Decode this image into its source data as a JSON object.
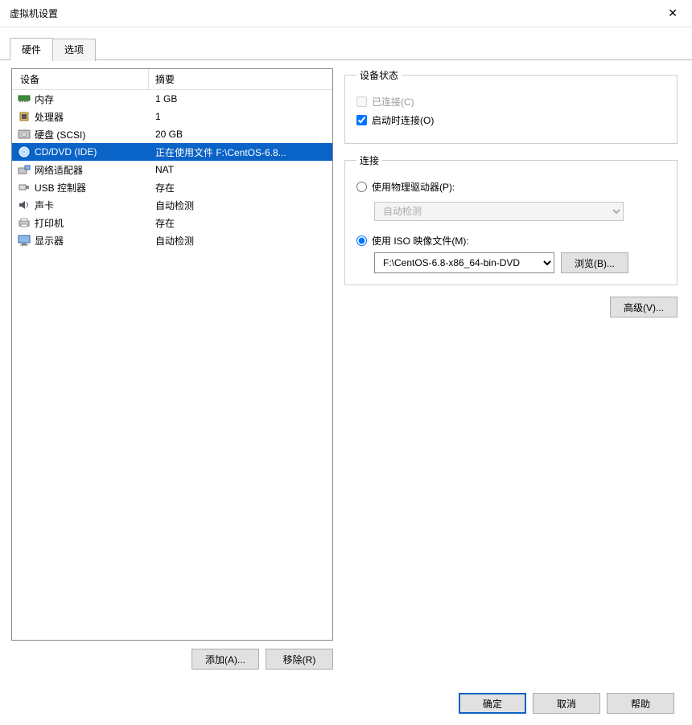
{
  "window": {
    "title": "虚拟机设置"
  },
  "tabs": {
    "hardware": "硬件",
    "options": "选项"
  },
  "columns": {
    "device": "设备",
    "summary": "摘要"
  },
  "devices": [
    {
      "icon": "memory",
      "name": "内存",
      "summary": "1 GB"
    },
    {
      "icon": "cpu",
      "name": "处理器",
      "summary": "1"
    },
    {
      "icon": "disk",
      "name": "硬盘 (SCSI)",
      "summary": "20 GB"
    },
    {
      "icon": "cd",
      "name": "CD/DVD (IDE)",
      "summary": "正在使用文件 F:\\CentOS-6.8..."
    },
    {
      "icon": "net",
      "name": "网络适配器",
      "summary": "NAT"
    },
    {
      "icon": "usb",
      "name": "USB 控制器",
      "summary": "存在"
    },
    {
      "icon": "sound",
      "name": "声卡",
      "summary": "自动检测"
    },
    {
      "icon": "printer",
      "name": "打印机",
      "summary": "存在"
    },
    {
      "icon": "display",
      "name": "显示器",
      "summary": "自动检测"
    }
  ],
  "selectedIndex": 3,
  "leftButtons": {
    "add": "添加(A)...",
    "remove": "移除(R)"
  },
  "deviceStatus": {
    "legend": "设备状态",
    "connected": {
      "label": "已连接(C)",
      "checked": false,
      "disabled": true
    },
    "connectAtStart": {
      "label": "启动时连接(O)",
      "checked": true
    }
  },
  "connection": {
    "legend": "连接",
    "physical": {
      "label": "使用物理驱动器(P):",
      "checked": false
    },
    "physicalSelectValue": "自动检测",
    "iso": {
      "label": "使用 ISO 映像文件(M):",
      "checked": true
    },
    "isoValue": "F:\\CentOS-6.8-x86_64-bin-DVD",
    "browse": "浏览(B)..."
  },
  "advanced": "高级(V)...",
  "footer": {
    "ok": "确定",
    "cancel": "取消",
    "help": "帮助"
  }
}
